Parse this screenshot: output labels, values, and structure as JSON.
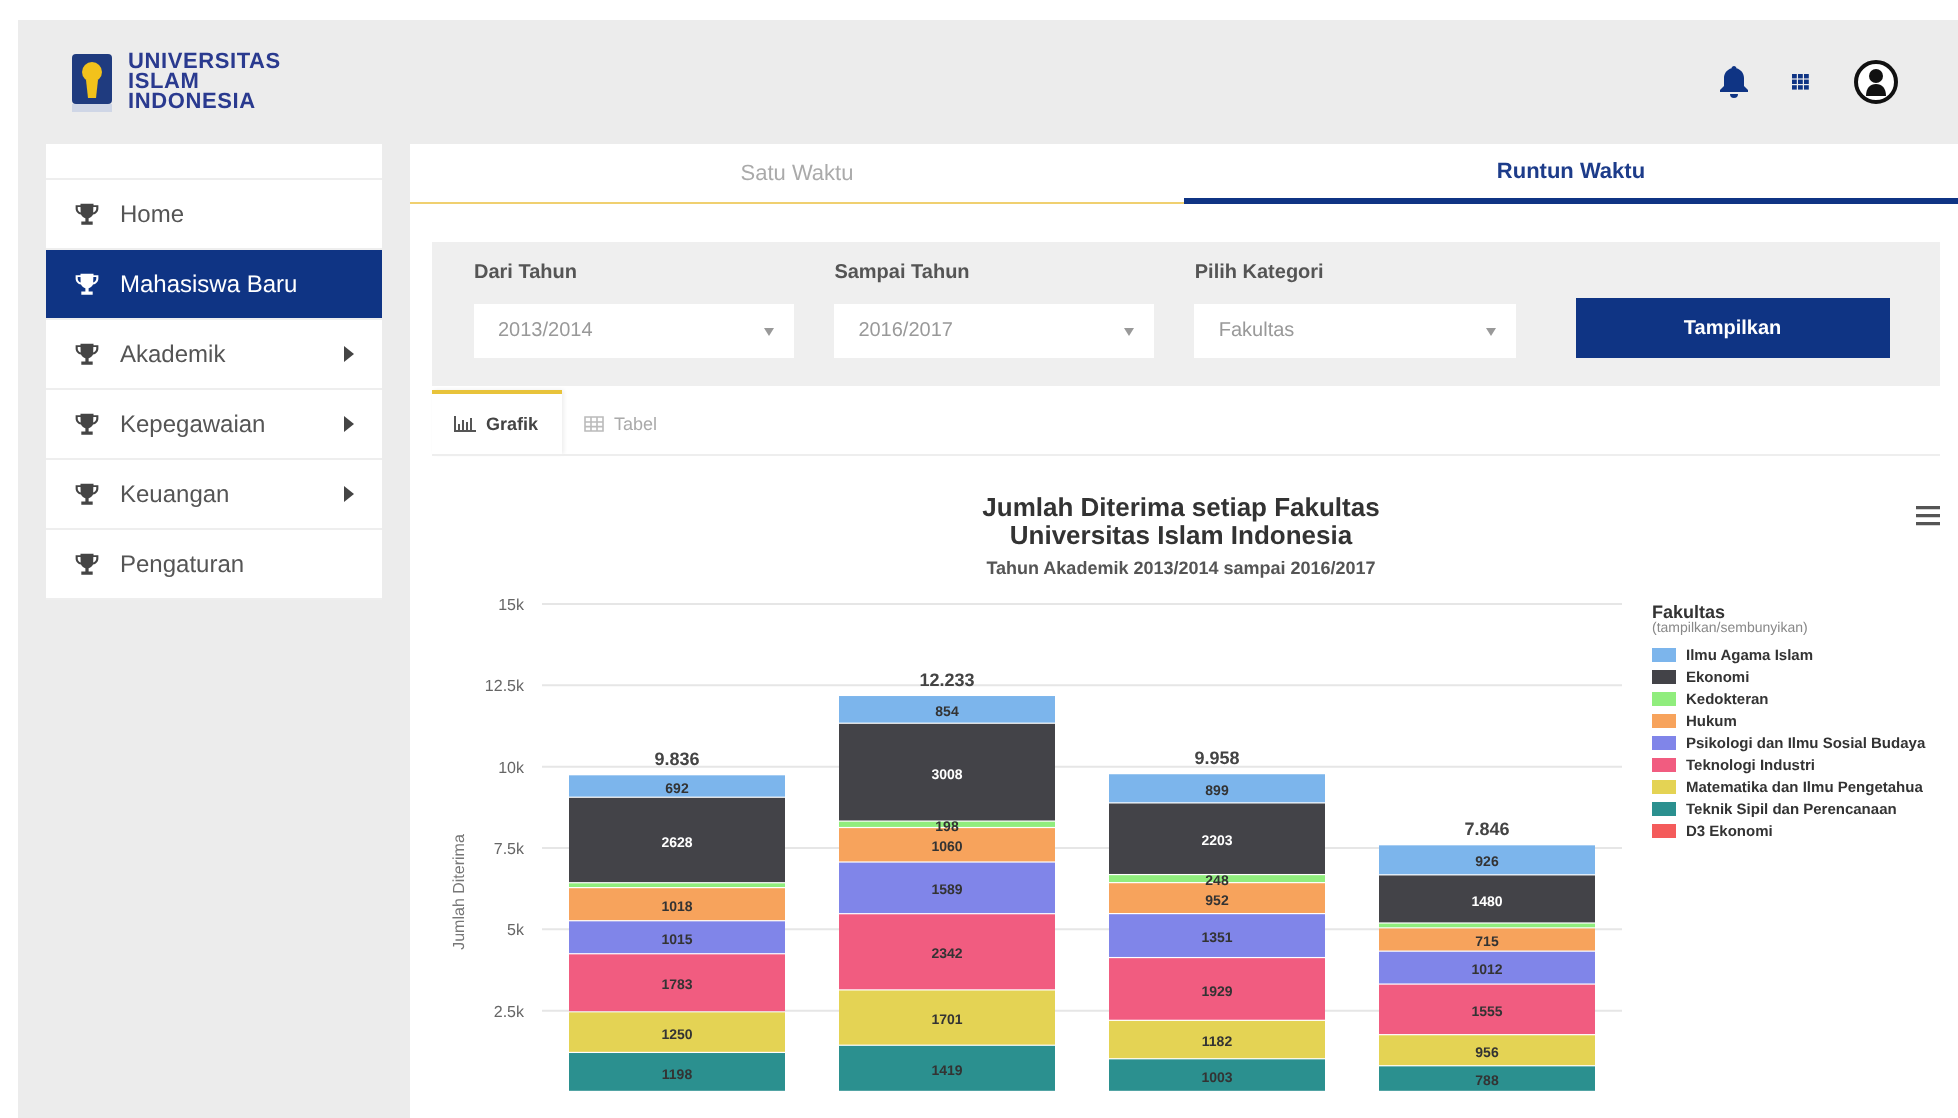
{
  "logo": {
    "lines": [
      "UNIVERSITAS",
      "ISLAM",
      "INDONESIA"
    ]
  },
  "sidebar": {
    "items": [
      {
        "label": "Home",
        "selected": false,
        "submenu": false
      },
      {
        "label": "Mahasiswa Baru",
        "selected": true,
        "submenu": false
      },
      {
        "label": "Akademik",
        "selected": false,
        "submenu": true
      },
      {
        "label": "Kepegawaian",
        "selected": false,
        "submenu": true
      },
      {
        "label": "Keuangan",
        "selected": false,
        "submenu": true
      },
      {
        "label": "Pengaturan",
        "selected": false,
        "submenu": false
      }
    ]
  },
  "mode_tabs": [
    {
      "label": "Satu Waktu",
      "selected": false
    },
    {
      "label": "Runtun Waktu",
      "selected": true
    }
  ],
  "filters": [
    {
      "label": "Dari Tahun",
      "value": "2013/2014"
    },
    {
      "label": "Sampai Tahun",
      "value": "2016/2017"
    },
    {
      "label": "Pilih Kategori",
      "value": "Fakultas"
    }
  ],
  "submit_button": "Tampilkan",
  "view_tabs": [
    {
      "label": "Grafik",
      "kind": "chart",
      "selected": true
    },
    {
      "label": "Tabel",
      "kind": "table",
      "selected": false
    }
  ],
  "chart": {
    "title_lines": [
      "Jumlah Diterima setiap Fakultas",
      "Universitas Islam Indonesia"
    ],
    "subtitle": "Tahun Akademik 2013/2014 sampai 2016/2017",
    "legend_title": "Fakultas",
    "legend_hint": "(tampilkan/sembunyikan)",
    "chart_data": {
      "type": "bar",
      "stacked": true,
      "ylabel": "Jumlah Diterima",
      "ylim": [
        0,
        15000
      ],
      "yticks": [
        {
          "value": 2500,
          "label": "2.5k"
        },
        {
          "value": 5000,
          "label": "5k"
        },
        {
          "value": 7500,
          "label": "7.5k"
        },
        {
          "value": 10000,
          "label": "10k"
        },
        {
          "value": 12500,
          "label": "12.5k"
        },
        {
          "value": 15000,
          "label": "15k"
        }
      ],
      "grid": true,
      "annotations": [
        "9.836",
        "12.233",
        "9.958",
        "7.846"
      ],
      "value_labels": [
        [
          "692",
          "854",
          "899",
          "926"
        ],
        [
          "2628",
          "3008",
          "2203",
          "1480"
        ],
        [
          null,
          "198",
          "248",
          null
        ],
        [
          "1018",
          "1060",
          "952",
          "715"
        ],
        [
          "1015",
          "1589",
          "1351",
          "1012"
        ],
        [
          "1783",
          "2342",
          "1929",
          "1555"
        ],
        [
          "1250",
          "1701",
          "1182",
          "956"
        ],
        [
          "1198",
          "1419",
          "1003",
          "788"
        ],
        [
          null,
          null,
          null,
          null
        ]
      ],
      "series": [
        {
          "name": "Ilmu Agama Islam",
          "color": "#7cb5ec",
          "values": [
            692,
            854,
            899,
            926
          ]
        },
        {
          "name": "Ekonomi",
          "color": "#434348",
          "values": [
            2628,
            3008,
            2203,
            1480
          ]
        },
        {
          "name": "Kedokteran",
          "color": "#90ed7d",
          "values": [
            150,
            198,
            248,
            150
          ]
        },
        {
          "name": "Hukum",
          "color": "#f7a35c",
          "values": [
            1018,
            1060,
            952,
            715
          ]
        },
        {
          "name": "Psikologi dan Ilmu Sosial Budaya",
          "color": "#8085e9",
          "values": [
            1015,
            1589,
            1351,
            1012
          ]
        },
        {
          "name": "Teknologi Industri",
          "color": "#f15c80",
          "values": [
            1783,
            2342,
            1929,
            1555
          ]
        },
        {
          "name": "Matematika dan Ilmu Pengetahua",
          "color": "#e4d354",
          "values": [
            1250,
            1701,
            1182,
            956
          ]
        },
        {
          "name": "Teknik Sipil dan Perencanaan",
          "color": "#2b908f",
          "values": [
            1198,
            1419,
            1003,
            788
          ]
        },
        {
          "name": "D3 Ekonomi",
          "color": "#f45b5b",
          "values": [
            null,
            null,
            null,
            null
          ]
        }
      ]
    }
  }
}
